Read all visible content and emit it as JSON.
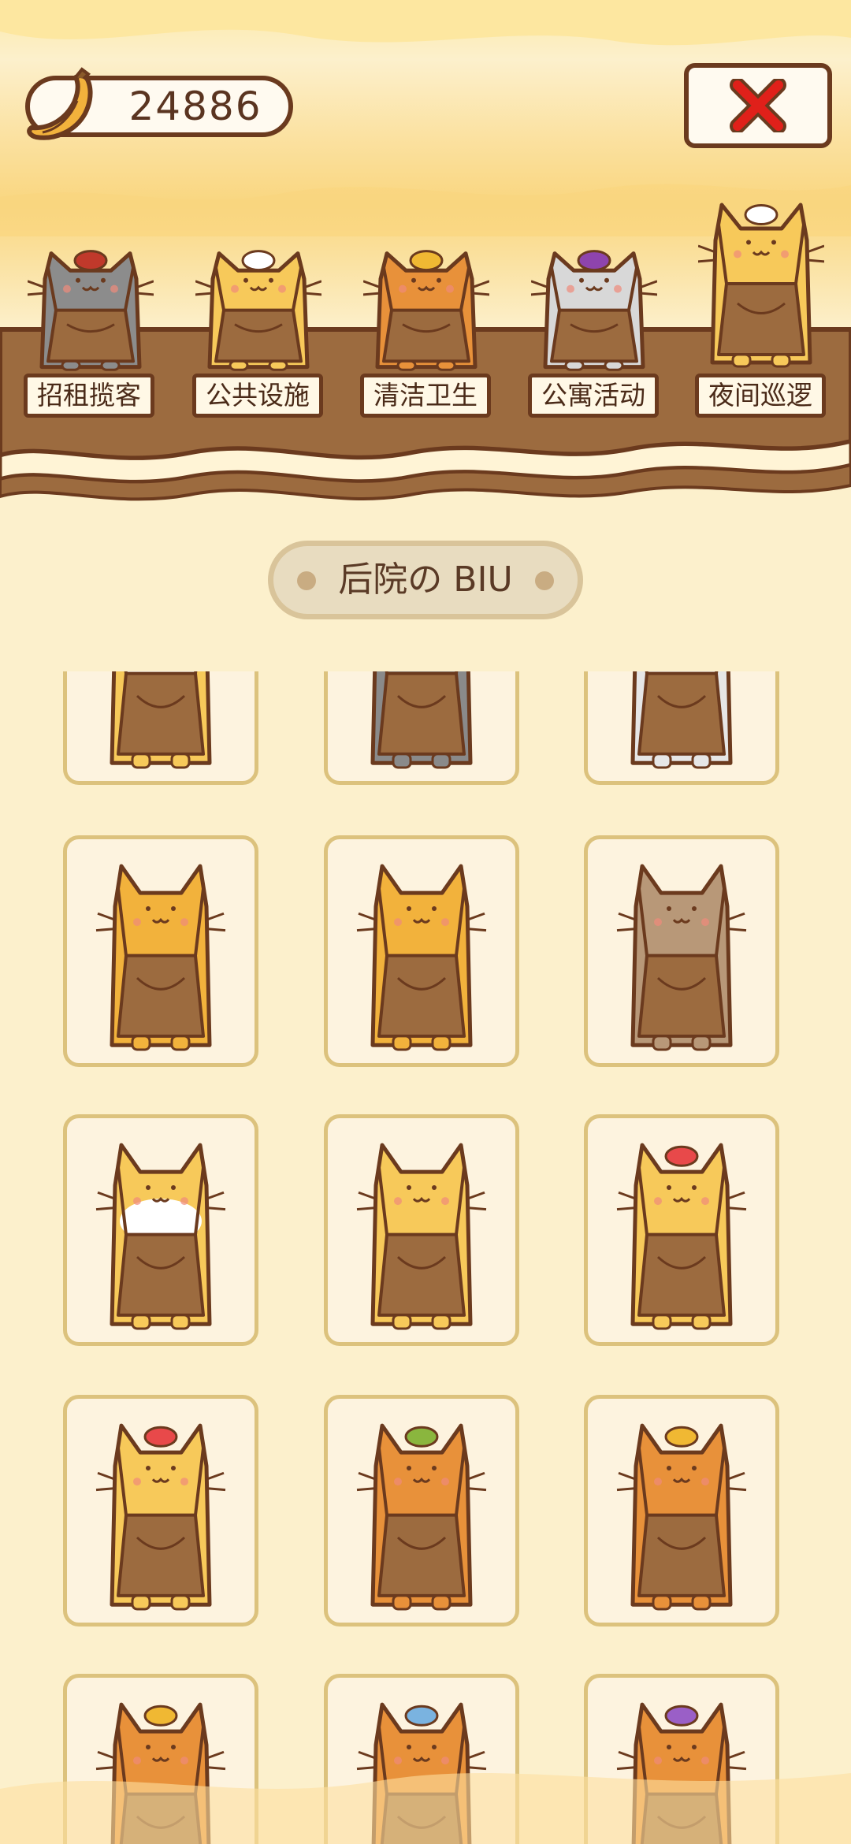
{
  "currency": {
    "icon": "banana-icon",
    "amount": "24886"
  },
  "close_button": {
    "icon": "close-icon"
  },
  "categories": [
    {
      "label": "招租揽客",
      "cat_color": "#8c8c8c",
      "hat": "red-beret"
    },
    {
      "label": "公共设施",
      "cat_color": "#f7c95a",
      "hat": "chef-hat"
    },
    {
      "label": "清洁卫生",
      "cat_color": "#e8913a",
      "hat": "crown"
    },
    {
      "label": "公寓活动",
      "cat_color": "#d8d8d8",
      "hat": "jester-hat"
    },
    {
      "label": "夜间巡逻",
      "cat_color": "#f7c95a",
      "hat": "chef-hat"
    }
  ],
  "section_title": "后院の BIU",
  "colors": {
    "background": "#fcf0cc",
    "outline": "#6b3a1e",
    "apron": "#9c6b3f",
    "card_border": "#dcc27d",
    "close_x": "#e0201a"
  },
  "cats": [
    {
      "body": "#f7c95a",
      "belly": "#ffffff",
      "hat": "#f0b833"
    },
    {
      "body": "#8a8a8a",
      "belly": "#8a8a8a",
      "hat": "#f0b833"
    },
    {
      "body": "#e6e6e6",
      "belly": "#e6e6e6",
      "hat": "#f0b833"
    },
    {
      "body": "#f2b23c",
      "belly": "#f2b23c",
      "hat": ""
    },
    {
      "body": "#f2b23c",
      "belly": "#f2b23c",
      "hat": ""
    },
    {
      "body": "#b89878",
      "belly": "#b89878",
      "hat": ""
    },
    {
      "body": "#f7c95a",
      "belly": "#ffffff",
      "hat": ""
    },
    {
      "body": "#f7c95a",
      "belly": "#f7c95a",
      "hat": ""
    },
    {
      "body": "#f7c95a",
      "belly": "#f7c95a",
      "hat": "#e8494a"
    },
    {
      "body": "#f7c95a",
      "belly": "#f7c95a",
      "hat": "#e8494a"
    },
    {
      "body": "#e8913a",
      "belly": "#e8913a",
      "hat": "#8ab63e"
    },
    {
      "body": "#e8913a",
      "belly": "#e8913a",
      "hat": "#f0b833"
    },
    {
      "body": "#e8913a",
      "belly": "#e8913a",
      "hat": "#f0b833"
    },
    {
      "body": "#e8913a",
      "belly": "#e8913a",
      "hat": "#7ab3e0"
    },
    {
      "body": "#e8913a",
      "belly": "#e8913a",
      "hat": "#9a5fc7"
    }
  ]
}
